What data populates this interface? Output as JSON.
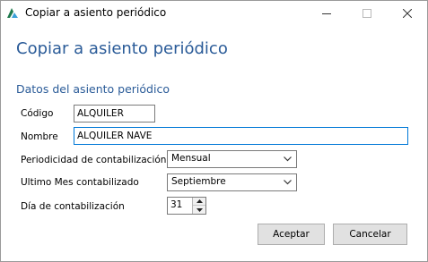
{
  "window": {
    "title": "Copiar a asiento periódico",
    "icon": "app-logo-icon",
    "controls": [
      "minimize-icon",
      "maximize-icon",
      "close-icon"
    ]
  },
  "heading": "Copiar a asiento periódico",
  "section_title": "Datos del asiento periódico",
  "fields": {
    "codigo": {
      "label": "Código",
      "value": "ALQUILER"
    },
    "nombre": {
      "label": "Nombre",
      "value": "ALQUILER NAVE"
    },
    "periodicidad": {
      "label": "Periodicidad de contabilización",
      "value": "Mensual"
    },
    "ultimo_mes": {
      "label": "Ultimo Mes contabilizado",
      "value": "Septiembre"
    },
    "dia": {
      "label": "Día de contabilización",
      "value": "31"
    }
  },
  "buttons": {
    "accept": "Aceptar",
    "cancel": "Cancelar"
  },
  "colors": {
    "accent": "#2a5b98",
    "focus_border": "#0078d7"
  }
}
